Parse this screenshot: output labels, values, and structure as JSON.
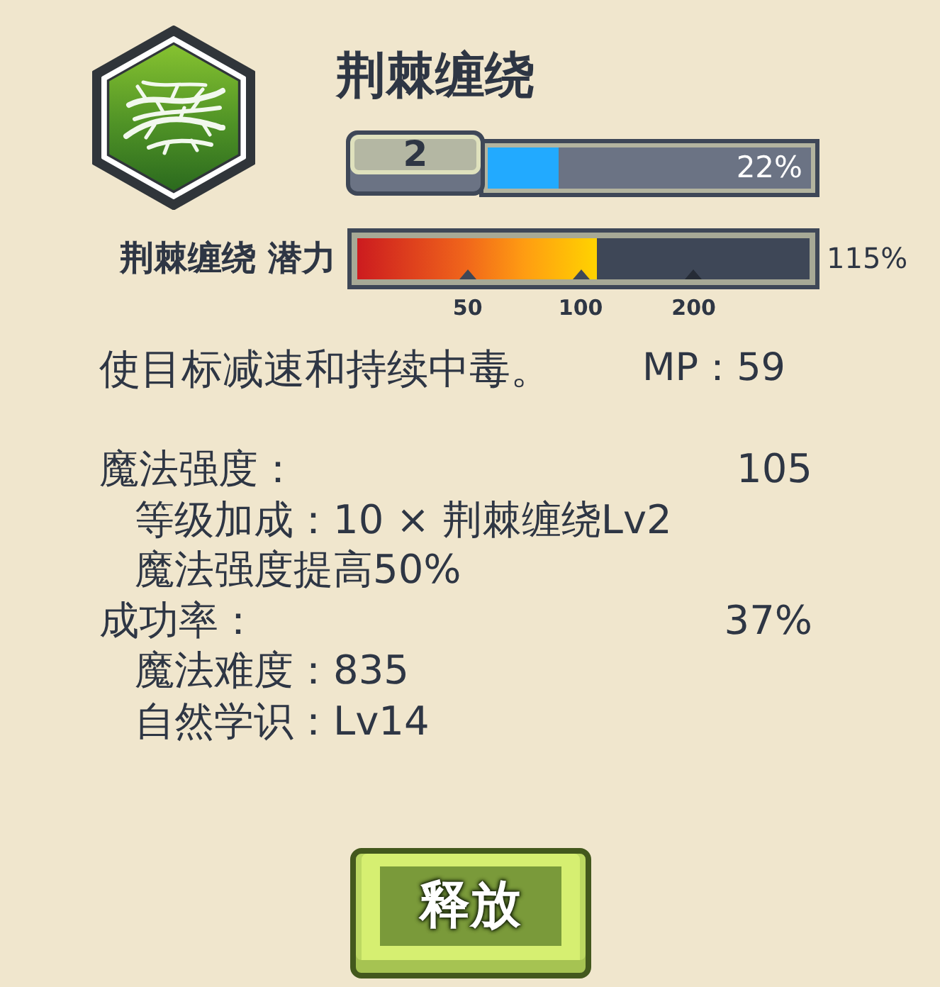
{
  "skill": {
    "title": "荆棘缠绕",
    "level_badge": "2",
    "progress": {
      "level": 0.22,
      "reading": "22%"
    }
  },
  "potential": {
    "label": "荆棘缠绕 潜力",
    "level": 0.53,
    "reading": "115%",
    "ticks": [
      "50",
      "100",
      "200"
    ]
  },
  "description": "使目标减速和持续中毒。",
  "mp": "MP：59",
  "stats": [
    {
      "label": "魔法强度：",
      "value": "105",
      "details": [
        "等级加成：10 × 荆棘缠绕Lv2",
        "魔法强度提高50%"
      ]
    },
    {
      "label": "成功率：",
      "value": "37%",
      "details": [
        "魔法难度：835",
        "自然学识：Lv14"
      ]
    }
  ],
  "button": "释放"
}
